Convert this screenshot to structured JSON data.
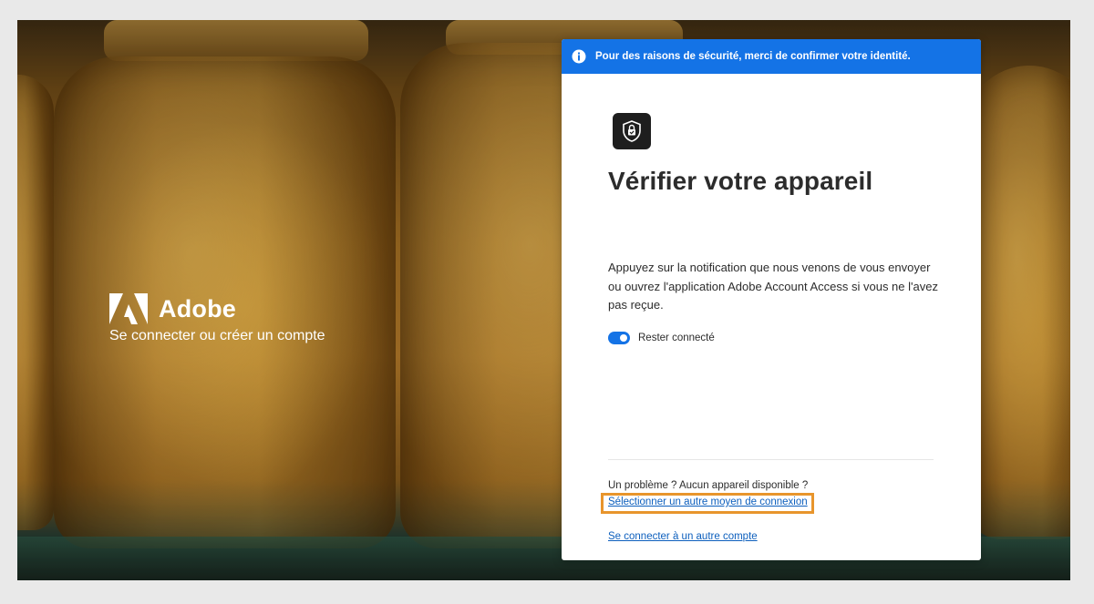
{
  "brand": {
    "name": "Adobe",
    "tagline": "Se connecter ou créer un compte"
  },
  "banner": {
    "icon": "info-icon",
    "text": "Pour des raisons de sécurité, merci de confirmer votre identité."
  },
  "card": {
    "app_icon": "shield-lock-icon",
    "title": "Vérifier votre appareil",
    "description": "Appuyez sur la notification que nous venons de vous envoyer ou ouvrez l'application Adobe Account Access si vous ne l'avez pas reçue.",
    "stay_signed_in": {
      "label": "Rester connecté",
      "enabled": true
    },
    "problem_text": "Un problème ? Aucun appareil disponible ?",
    "select_other_method_link": "Sélectionner un autre moyen de connexion",
    "other_account_link": "Se connecter à un autre compte"
  },
  "colors": {
    "accent": "#1473e6",
    "link": "#0d5fbd",
    "highlight": "#e8952c",
    "text": "#2c2c2c"
  }
}
